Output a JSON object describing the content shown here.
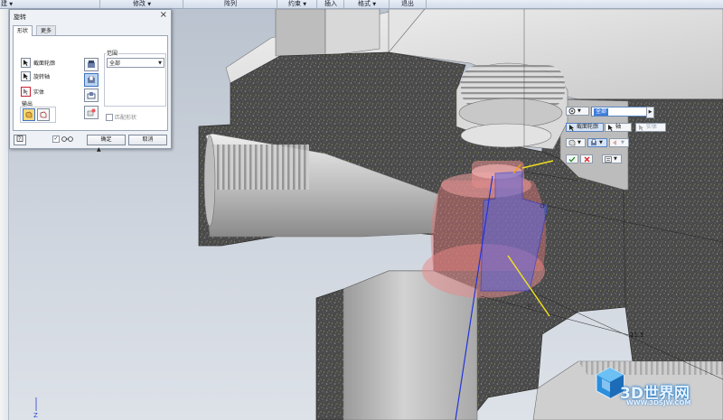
{
  "ribbon": {
    "groups": [
      {
        "label": "建"
      },
      {
        "label": "修改"
      },
      {
        "label": "阵列"
      },
      {
        "label": "约束"
      },
      {
        "label": "插入"
      },
      {
        "label": "格式"
      },
      {
        "label": "退出"
      }
    ]
  },
  "dialog": {
    "title": "旋转",
    "tabs": [
      "形状",
      "更多"
    ],
    "selectors": [
      "截面轮廓",
      "旋转轴",
      "实体"
    ],
    "output_label": "输出",
    "range_label": "范围",
    "range_value": "全部",
    "match_shape": "匹配形状",
    "ok": "确定",
    "cancel": "取消"
  },
  "mini_toolbar": {
    "angle_value": "全部",
    "profile": "截面轮廓",
    "axis": "轴",
    "solid": "实体"
  },
  "viewport": {
    "dimension": "11.5",
    "axis_z": "Z"
  },
  "watermark": {
    "brand": "3D世界网",
    "url": "WWW.3DSJW.COM"
  },
  "colors": {
    "sketch_blue": "#2233dd",
    "preview_red": "#e06a6a",
    "axis_yellow": "#f0e020",
    "section_gray": "#4b4b4b",
    "background_top": "#b9c2ce"
  }
}
